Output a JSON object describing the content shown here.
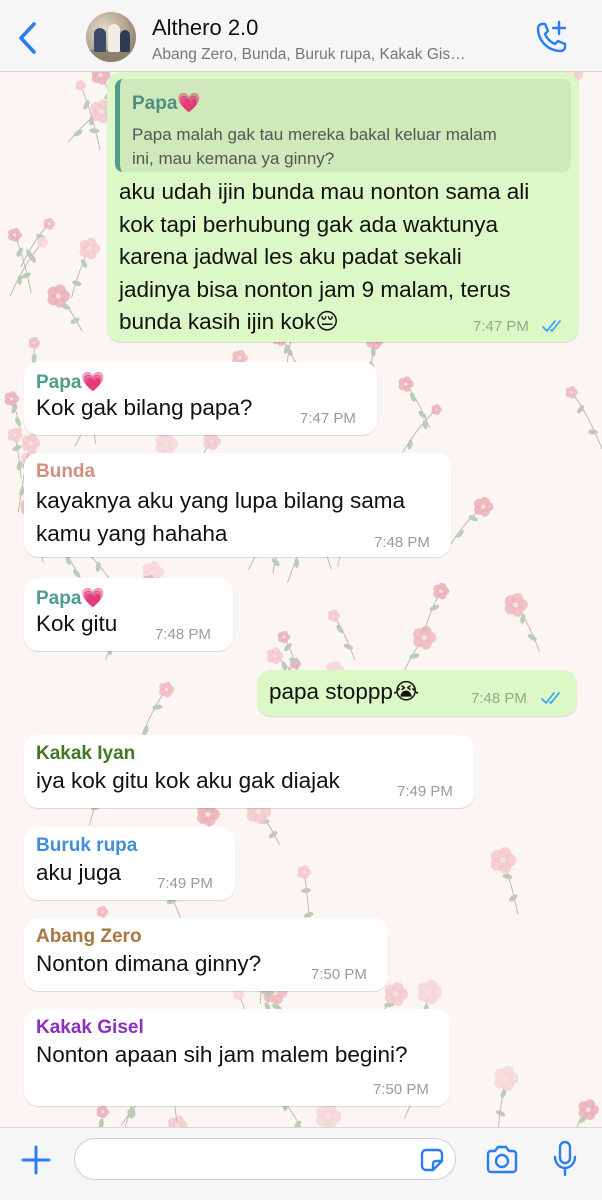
{
  "header": {
    "back_icon": "chevron-left-icon",
    "title": "Althero 2.0",
    "members": "Abang Zero, Bunda, Buruk rupa, Kakak Gis…",
    "call_icon": "phone-plus-icon"
  },
  "colors": {
    "accent": "#2a7ef5",
    "outgoing_bubble": "#dcf8c6",
    "incoming_bubble": "#ffffff",
    "read_ticks": "#34a4f0"
  },
  "messages": [
    {
      "direction": "out",
      "quote": {
        "sender": "Papa💗",
        "lines": [
          "Papa malah gak tau mereka bakal keluar malam",
          "ini, mau kemana ya ginny?"
        ]
      },
      "lines": [
        "aku udah ijin bunda mau nonton sama ali",
        "kok tapi berhubung gak ada waktunya",
        "karena jadwal les aku padat sekali",
        "jadinya bisa nonton jam 9 malam, terus",
        "bunda kasih ijin kok😔"
      ],
      "time": "7:47 PM",
      "status": "read"
    },
    {
      "direction": "in",
      "sender": "Papa💗",
      "sender_color": "#4f9d8c",
      "lines": [
        "Kok gak bilang papa?"
      ],
      "time": "7:47 PM"
    },
    {
      "direction": "in",
      "sender": "Bunda",
      "sender_color": "#d28f84",
      "lines": [
        "kayaknya aku yang lupa bilang sama",
        "kamu yang hahaha"
      ],
      "time": "7:48 PM"
    },
    {
      "direction": "in",
      "sender": "Papa💗",
      "sender_color": "#4f9d8c",
      "lines": [
        "Kok gitu"
      ],
      "time": "7:48 PM"
    },
    {
      "direction": "out",
      "lines": [
        "papa stoppp😭"
      ],
      "time": "7:48 PM",
      "status": "read"
    },
    {
      "direction": "in",
      "sender": "Kakak Iyan",
      "sender_color": "#3f7a22",
      "lines": [
        "iya kok gitu kok aku gak diajak"
      ],
      "time": "7:49 PM"
    },
    {
      "direction": "in",
      "sender": "Buruk rupa",
      "sender_color": "#3f8fd9",
      "lines": [
        "aku juga"
      ],
      "time": "7:49 PM"
    },
    {
      "direction": "in",
      "sender": "Abang Zero",
      "sender_color": "#a97740",
      "lines": [
        "Nonton dimana ginny?"
      ],
      "time": "7:50 PM"
    },
    {
      "direction": "in",
      "sender": "Kakak Gisel",
      "sender_color": "#8a2fc2",
      "lines": [
        "Nonton apaan sih jam malem begini?"
      ],
      "time": "7:50 PM"
    }
  ],
  "input_bar": {
    "plus_icon": "plus-icon",
    "message_placeholder": "",
    "sticker_icon": "sticker-icon",
    "camera_icon": "camera-icon",
    "mic_icon": "microphone-icon"
  }
}
